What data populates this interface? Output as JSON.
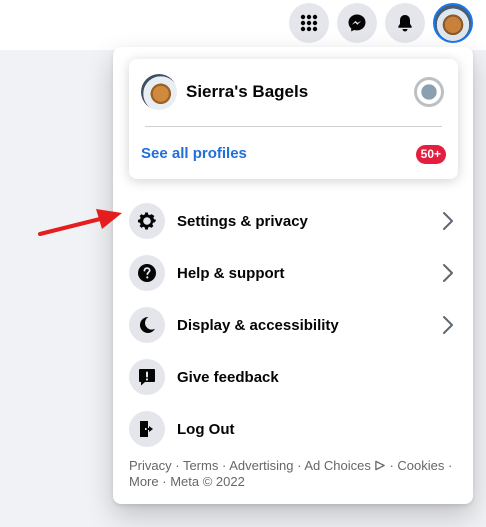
{
  "topbar": {
    "icons": [
      "menu-grid-icon",
      "messenger-icon",
      "notifications-bell-icon",
      "account-avatar"
    ]
  },
  "profile": {
    "name": "Sierra's Bagels",
    "see_all": "See all profiles",
    "badge": "50+"
  },
  "menu": {
    "items": [
      {
        "label": "Settings & privacy",
        "icon": "gear-icon",
        "chevron": true
      },
      {
        "label": "Help & support",
        "icon": "question-icon",
        "chevron": true
      },
      {
        "label": "Display & accessibility",
        "icon": "moon-icon",
        "chevron": true
      },
      {
        "label": "Give feedback",
        "icon": "feedback-icon",
        "chevron": false
      },
      {
        "label": "Log Out",
        "icon": "logout-icon",
        "chevron": false
      }
    ]
  },
  "footer": {
    "privacy": "Privacy",
    "terms": "Terms",
    "advertising": "Advertising",
    "ad_choices": "Ad Choices",
    "cookies": "Cookies",
    "more": "More",
    "meta": "Meta © 2022",
    "sep": " · "
  },
  "colors": {
    "accent": "#1877f2",
    "link": "#216fdb",
    "badge": "#e41e3f",
    "annotation_arrow": "#e41e1e"
  }
}
